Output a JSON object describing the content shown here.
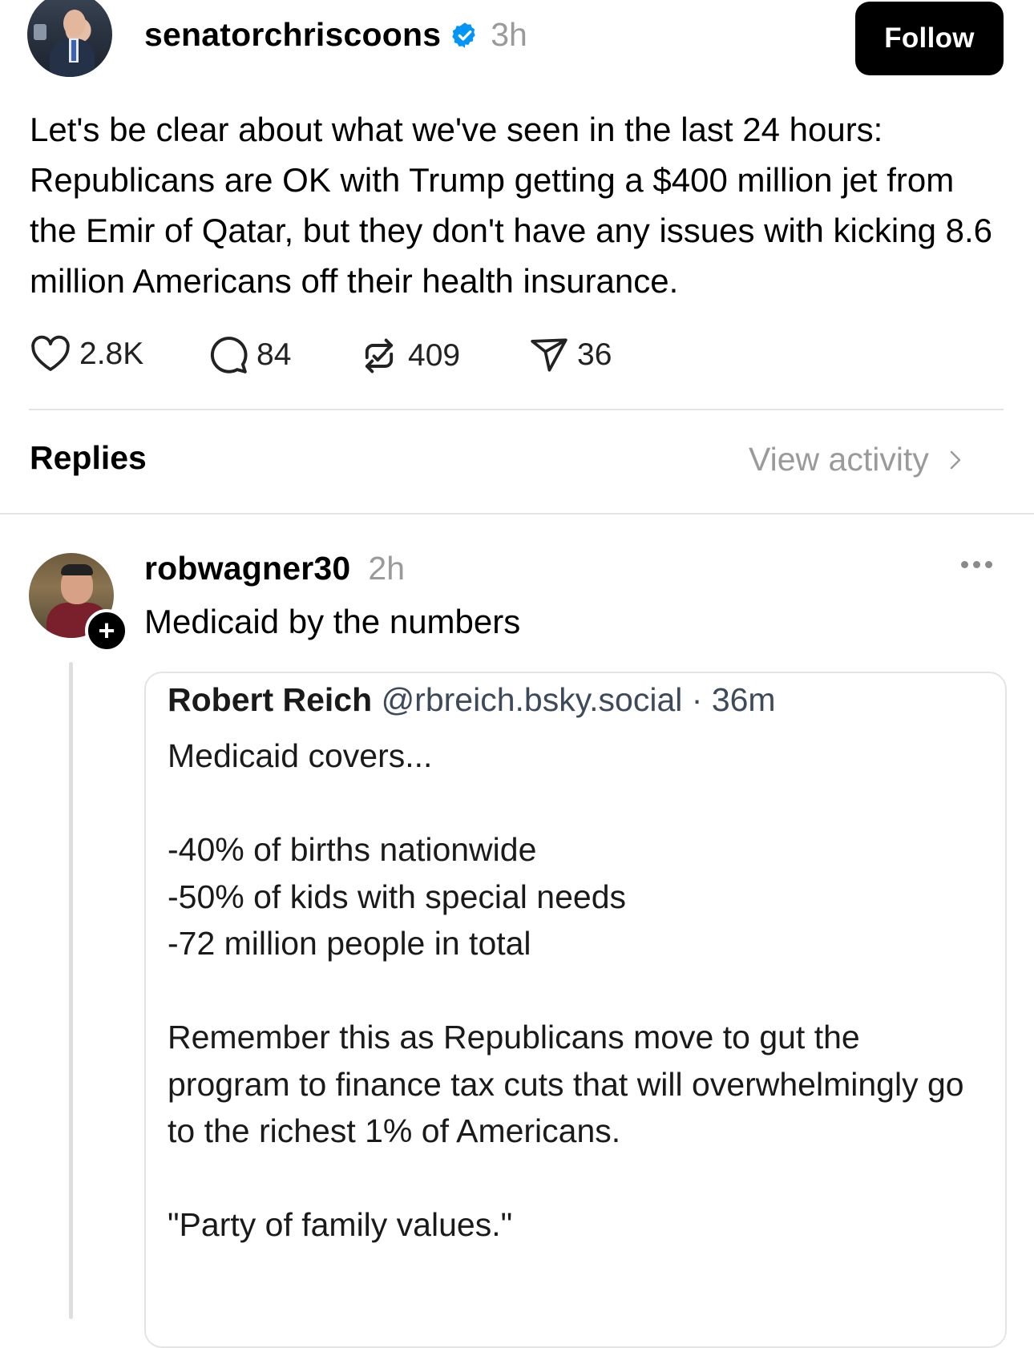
{
  "post": {
    "username": "senatorchriscoons",
    "time": "3h",
    "follow_label": "Follow",
    "text": "Let's be clear about what we've seen in the last 24 hours: Republicans are OK with Trump getting a $400 million jet from the Emir of Qatar, but they don't have any issues with kicking 8.6 million Americans off their health insurance.",
    "likes": "2.8K",
    "comments": "84",
    "reposts": "409",
    "shares": "36"
  },
  "replies_header": {
    "label": "Replies",
    "view_activity": "View activity"
  },
  "reply": {
    "username": "robwagner30",
    "time": "2h",
    "text": "Medicaid by the numbers",
    "quote": {
      "name": "Robert Reich",
      "handle": "@rbreich.bsky.social",
      "separator": " · ",
      "time": "36m",
      "body": "Medicaid covers...\n\n-40% of births nationwide\n-50% of kids with special needs\n-72 million people in total\n\nRemember this as Republicans move to gut the program to finance tax cuts that will overwhelmingly go to the richest 1% of Americans.\n\n\"Party of family values.\""
    }
  },
  "colors": {
    "verified": "#0095f6",
    "muted_text": "#9a9a9a",
    "follow_bg": "#000000"
  },
  "icons": {
    "like": "heart-icon",
    "comment": "comment-bubble-icon",
    "repost": "repost-icon",
    "share": "send-icon",
    "verified": "verified-badge-icon",
    "more": "more-dots-icon",
    "chevron": "chevron-right-icon",
    "follow_plus": "plus-icon"
  }
}
